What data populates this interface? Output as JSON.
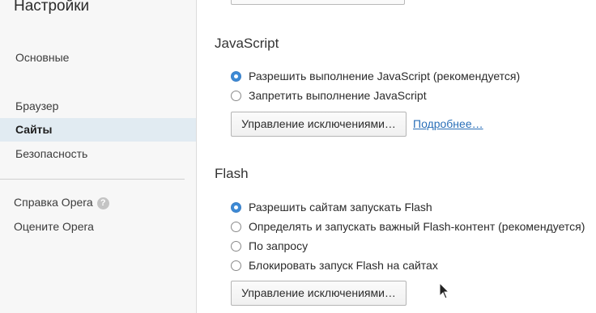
{
  "sidebar": {
    "title": "Настройки",
    "items": [
      {
        "label": "Основные"
      },
      {
        "label": "Браузер"
      },
      {
        "label": "Сайты"
      },
      {
        "label": "Безопасность"
      }
    ],
    "links": [
      {
        "label": "Справка Opera",
        "icon": "help-icon"
      },
      {
        "label": "Оцените Opera"
      }
    ]
  },
  "javascript": {
    "title": "JavaScript",
    "options": [
      {
        "label": "Разрешить выполнение JavaScript (рекомендуется)",
        "checked": true
      },
      {
        "label": "Запретить выполнение JavaScript",
        "checked": false
      }
    ],
    "exceptions_button": "Управление исключениями…",
    "more_link": "Подробнее…"
  },
  "flash": {
    "title": "Flash",
    "options": [
      {
        "label": "Разрешить сайтам запускать Flash",
        "checked": true
      },
      {
        "label": "Определять и запускать важный Flash-контент (рекомендуется)",
        "checked": false
      },
      {
        "label": "По запросу",
        "checked": false
      },
      {
        "label": "Блокировать запуск Flash на сайтах",
        "checked": false
      }
    ],
    "exceptions_button": "Управление исключениями…"
  },
  "colors": {
    "accent": "#3d8ad5",
    "link": "#2a6fb8",
    "sidebar_active": "#e1ebf2"
  }
}
